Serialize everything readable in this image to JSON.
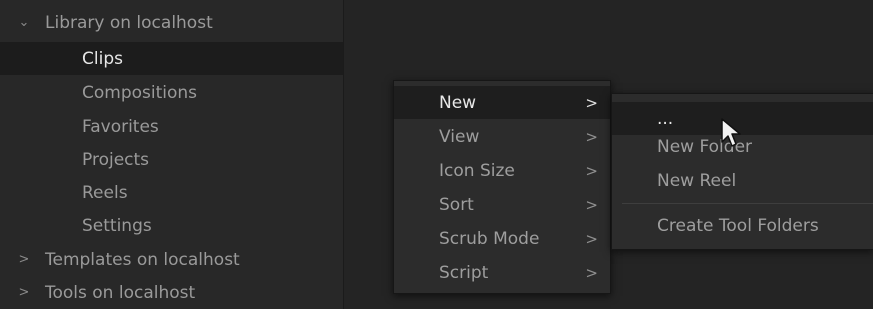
{
  "sidebar": {
    "library": {
      "chevron": "chevron-down-icon",
      "label": "Library on localhost"
    },
    "children": [
      {
        "label": "Clips",
        "selected": true
      },
      {
        "label": "Compositions"
      },
      {
        "label": "Favorites"
      },
      {
        "label": "Projects"
      },
      {
        "label": "Reels"
      },
      {
        "label": "Settings"
      }
    ],
    "templates": {
      "chevron": "chevron-right-icon",
      "label": "Templates on localhost"
    },
    "tools": {
      "chevron": "chevron-right-icon",
      "label": "Tools on localhost"
    }
  },
  "context_menu": {
    "items": [
      {
        "label": "New",
        "active": true
      },
      {
        "label": "View"
      },
      {
        "label": "Icon Size"
      },
      {
        "label": "Sort"
      },
      {
        "label": "Scrub Mode"
      },
      {
        "label": "Script"
      }
    ],
    "submenu_arrow": ">"
  },
  "submenu": {
    "items": [
      {
        "label": "...",
        "hover": true
      },
      {
        "label": "New Folder"
      },
      {
        "label": "New Reel"
      }
    ],
    "footer_item": "Create Tool Folders"
  },
  "glyphs": {
    "chevron_down": "⌄",
    "chevron_right": ">"
  }
}
